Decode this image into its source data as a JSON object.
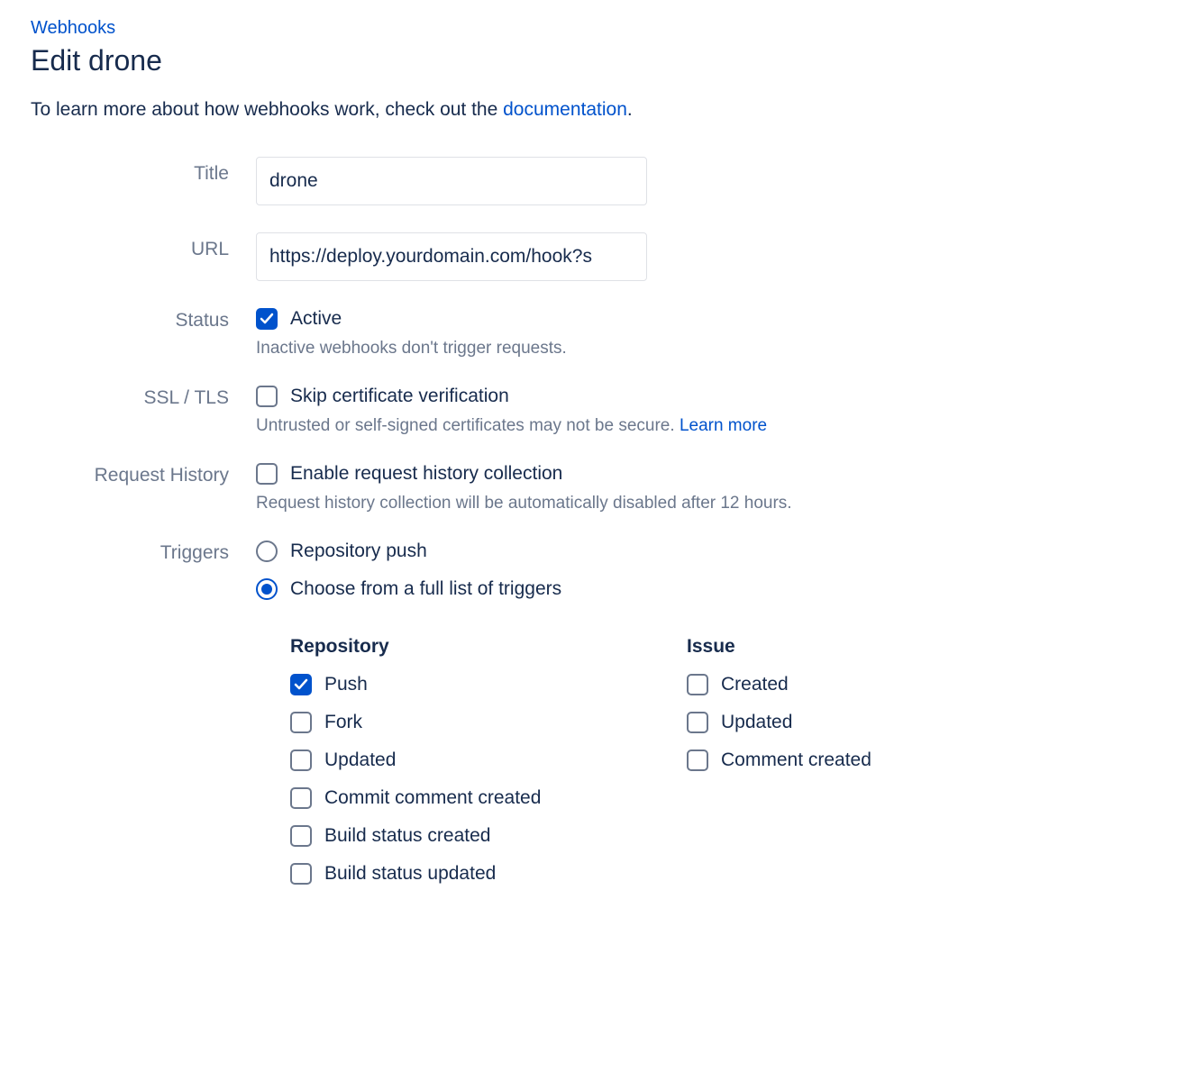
{
  "breadcrumb": {
    "label": "Webhooks"
  },
  "page_title": "Edit drone",
  "intro": {
    "text_before": "To learn more about how webhooks work, check out the ",
    "link": "documentation",
    "text_after": "."
  },
  "fields": {
    "title": {
      "label": "Title",
      "value": "drone"
    },
    "url": {
      "label": "URL",
      "value": "https://deploy.yourdomain.com/hook?s"
    },
    "status": {
      "label": "Status",
      "checkbox_label": "Active",
      "checked": true,
      "help": "Inactive webhooks don't trigger requests."
    },
    "ssl": {
      "label": "SSL / TLS",
      "checkbox_label": "Skip certificate verification",
      "checked": false,
      "help_text": "Untrusted or self-signed certificates may not be secure. ",
      "help_link": "Learn more"
    },
    "history": {
      "label": "Request History",
      "checkbox_label": "Enable request history collection",
      "checked": false,
      "help": "Request history collection will be automatically disabled after 12 hours."
    },
    "triggers": {
      "label": "Triggers",
      "option_push": "Repository push",
      "option_full": "Choose from a full list of triggers",
      "selected": "full",
      "groups": [
        {
          "header": "Repository",
          "items": [
            {
              "label": "Push",
              "checked": true
            },
            {
              "label": "Fork",
              "checked": false
            },
            {
              "label": "Updated",
              "checked": false
            },
            {
              "label": "Commit comment created",
              "checked": false
            },
            {
              "label": "Build status created",
              "checked": false
            },
            {
              "label": "Build status updated",
              "checked": false
            }
          ]
        },
        {
          "header": "Issue",
          "items": [
            {
              "label": "Created",
              "checked": false
            },
            {
              "label": "Updated",
              "checked": false
            },
            {
              "label": "Comment created",
              "checked": false
            }
          ]
        }
      ]
    }
  }
}
